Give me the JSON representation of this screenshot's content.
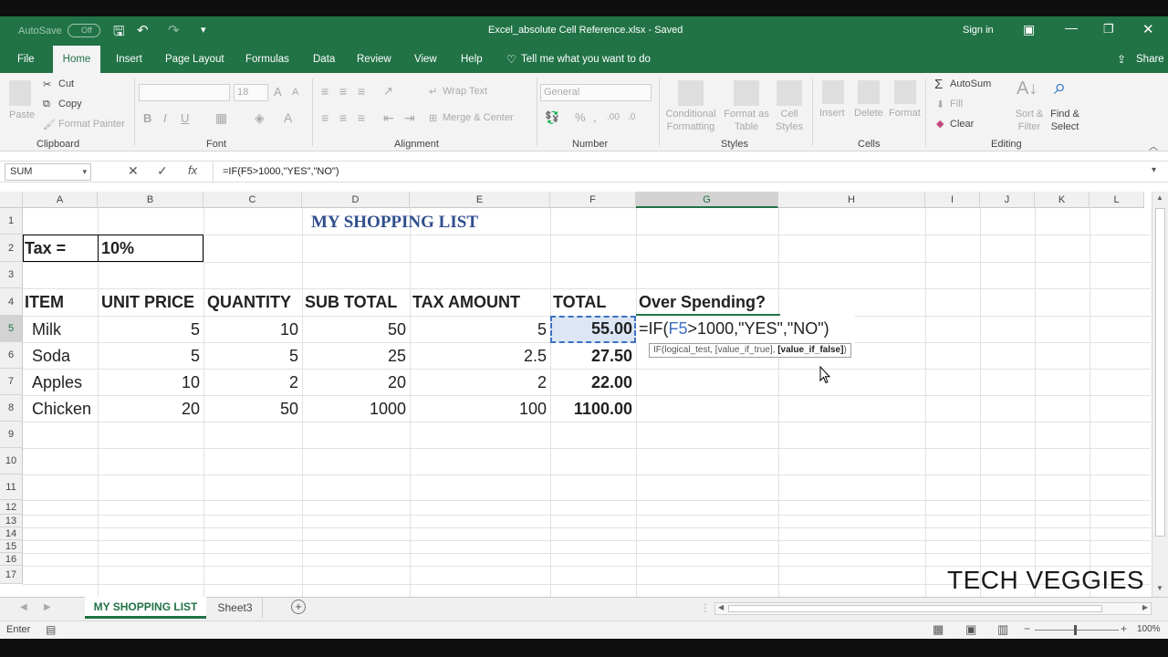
{
  "title_bar": {
    "autosave_label": "AutoSave",
    "autosave_state": "Off",
    "filename": "Excel_absolute Cell Reference.xlsx  -  Saved",
    "sign_in": "Sign in"
  },
  "tabs": [
    "File",
    "Home",
    "Insert",
    "Page Layout",
    "Formulas",
    "Data",
    "Review",
    "View",
    "Help"
  ],
  "tell_me": "Tell me what you want to do",
  "share": "Share",
  "ribbon": {
    "clipboard": {
      "paste": "Paste",
      "cut": "Cut",
      "copy": "Copy",
      "format_painter": "Format Painter",
      "group": "Clipboard"
    },
    "font": {
      "font_size": "18",
      "group": "Font"
    },
    "alignment": {
      "wrap_text": "Wrap Text",
      "merge_center": "Merge & Center",
      "group": "Alignment"
    },
    "number": {
      "format": "General",
      "group": "Number"
    },
    "styles": {
      "conditional_formatting": "Conditional Formatting",
      "format_as_table": "Format as Table",
      "cell_styles": "Cell Styles",
      "group": "Styles"
    },
    "cells": {
      "insert": "Insert",
      "delete": "Delete",
      "format": "Format",
      "group": "Cells"
    },
    "editing": {
      "autosum": "AutoSum",
      "fill": "Fill",
      "clear": "Clear",
      "sort_filter": "Sort & Filter",
      "find_select": "Find & Select",
      "group": "Editing"
    }
  },
  "formula_bar": {
    "name_box": "SUM",
    "formula": "=IF(F5>1000,\"YES\",\"NO\")"
  },
  "columns": [
    "A",
    "B",
    "C",
    "D",
    "E",
    "F",
    "G",
    "H",
    "I",
    "J",
    "K",
    "L"
  ],
  "rows": [
    "1",
    "2",
    "3",
    "4",
    "5",
    "6",
    "7",
    "8",
    "9",
    "10",
    "11",
    "12",
    "13",
    "14",
    "15",
    "16",
    "17"
  ],
  "sheet": {
    "title": "MY SHOPPING LIST",
    "tax_label": "Tax =",
    "tax_value": "10%",
    "headers": [
      "ITEM",
      "UNIT PRICE",
      "QUANTITY",
      "SUB TOTAL",
      "TAX AMOUNT",
      "TOTAL",
      "Over Spending?"
    ],
    "data": [
      [
        "Milk",
        "5",
        "10",
        "50",
        "5",
        "55.00"
      ],
      [
        "Soda",
        "5",
        "5",
        "25",
        "2.5",
        "27.50"
      ],
      [
        "Apples",
        "10",
        "2",
        "20",
        "2",
        "22.00"
      ],
      [
        "Chicken",
        "20",
        "50",
        "1000",
        "100",
        "1100.00"
      ]
    ],
    "edit_prefix": "=IF(",
    "edit_ref": "F5",
    "edit_suffix": ">1000,\"YES\",\"NO\")",
    "tooltip_args": "IF(logical_test, [value_if_true], ",
    "tooltip_bold": "[value_if_false]",
    "tooltip_end": ")"
  },
  "watermark": "TECH VEGGIES",
  "sheet_tabs": [
    "MY SHOPPING LIST",
    "Sheet3"
  ],
  "status": {
    "mode": "Enter",
    "zoom": "100%"
  },
  "colors": {
    "excel_green": "#217346",
    "ref_blue": "#3e70c4",
    "title_blue": "#2f4e8c"
  }
}
